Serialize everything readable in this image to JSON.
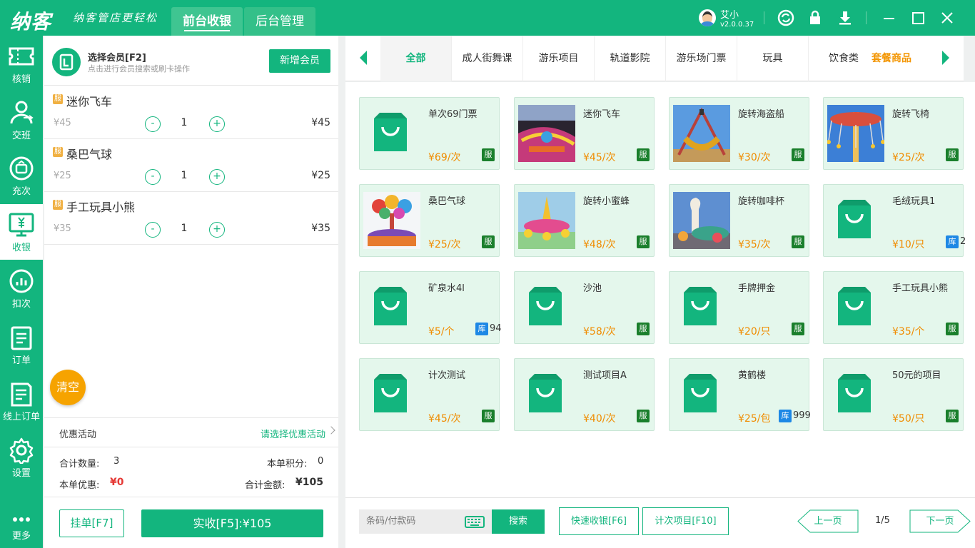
{
  "app": {
    "logo": "纳客",
    "slogan": "纳客管店更轻松",
    "tabs": [
      {
        "label": "前台收银",
        "active": true
      },
      {
        "label": "后台管理",
        "active": false
      }
    ],
    "user": {
      "name": "艾小",
      "version": "v2.0.0.37"
    },
    "header_icons": [
      "refresh-icon",
      "lock-icon",
      "download-icon",
      "minimize-icon",
      "maximize-icon",
      "close-icon"
    ]
  },
  "sidebar": {
    "items": [
      {
        "label": "核销",
        "icon": "ticket-icon"
      },
      {
        "label": "交班",
        "icon": "handover-icon"
      },
      {
        "label": "充次",
        "icon": "recharge-icon"
      },
      {
        "label": "收银",
        "icon": "cashier-icon",
        "active": true
      },
      {
        "label": "扣次",
        "icon": "deduct-icon"
      },
      {
        "label": "订单",
        "icon": "order-icon"
      },
      {
        "label": "线上订单",
        "icon": "online-order-icon"
      },
      {
        "label": "设置",
        "icon": "gear-icon"
      },
      {
        "label": "更多",
        "icon": "more-icon"
      }
    ]
  },
  "cart": {
    "member_title": "选择会员[F2]",
    "member_hint": "点击进行会员搜索或刷卡操作",
    "add_member": "新增会员",
    "items": [
      {
        "badge": "服",
        "name": "迷你飞车",
        "price": "¥45",
        "qty": "1",
        "subtotal": "¥45"
      },
      {
        "badge": "服",
        "name": "桑巴气球",
        "price": "¥25",
        "qty": "1",
        "subtotal": "¥25"
      },
      {
        "badge": "服",
        "name": "手工玩具小熊",
        "price": "¥35",
        "qty": "1",
        "subtotal": "¥35"
      }
    ],
    "minus": "-",
    "plus": "+",
    "clear": "清空",
    "promo_label": "优惠活动",
    "promo_select": "请选择优惠活动",
    "total_qty_label": "合计数量:",
    "total_qty": "3",
    "points_label": "本单积分:",
    "points": "0",
    "discount_label": "本单优惠:",
    "discount": "¥0",
    "total_label": "合计金额:",
    "total": "¥105",
    "hang_btn": "挂单[F7]",
    "pay_btn": "实收[F5]:¥105"
  },
  "categories": [
    {
      "label": "全部",
      "active": true
    },
    {
      "label": "成人街舞课"
    },
    {
      "label": "游乐项目"
    },
    {
      "label": "轨道影院"
    },
    {
      "label": "游乐场门票"
    },
    {
      "label": "玩具"
    },
    {
      "label": "饮食类"
    },
    {
      "label": "套餐商品",
      "special": true
    }
  ],
  "products": [
    {
      "name": "单次69门票",
      "price": "¥69/次",
      "tag": "服",
      "img": "bag"
    },
    {
      "name": "迷你飞车",
      "price": "¥45/次",
      "tag": "服",
      "img": "minicar"
    },
    {
      "name": "旋转海盗船",
      "price": "¥30/次",
      "tag": "服",
      "img": "pirate"
    },
    {
      "name": "旋转飞椅",
      "price": "¥25/次",
      "tag": "服",
      "img": "chair"
    },
    {
      "name": "桑巴气球",
      "price": "¥25/次",
      "tag": "服",
      "img": "balloon"
    },
    {
      "name": "旋转小蜜蜂",
      "price": "¥48/次",
      "tag": "服",
      "img": "bee"
    },
    {
      "name": "旋转咖啡杯",
      "price": "¥35/次",
      "tag": "服",
      "img": "cup"
    },
    {
      "name": "毛绒玩具1",
      "price": "¥10/只",
      "tag": "库",
      "stock": "2",
      "img": "bag"
    },
    {
      "name": "矿泉水4l",
      "price": "¥5/个",
      "tag": "库",
      "stock": "94",
      "img": "bag"
    },
    {
      "name": "沙池",
      "price": "¥58/次",
      "tag": "服",
      "img": "bag"
    },
    {
      "name": "手牌押金",
      "price": "¥20/只",
      "tag": "服",
      "img": "bag"
    },
    {
      "name": "手工玩具小熊",
      "price": "¥35/个",
      "tag": "服",
      "img": "bag"
    },
    {
      "name": "计次测试",
      "price": "¥45/次",
      "tag": "服",
      "img": "bag"
    },
    {
      "name": "测试项目A",
      "price": "¥40/次",
      "tag": "服",
      "img": "bag"
    },
    {
      "name": "黄鹤楼",
      "price": "¥25/包",
      "tag": "库",
      "stock": "999",
      "img": "bag"
    },
    {
      "name": "50元的项目",
      "price": "¥50/只",
      "tag": "服",
      "img": "bag"
    }
  ],
  "bottom": {
    "scan_placeholder": "条码/付款码",
    "search": "搜索",
    "quick_cash": "快速收银[F6]",
    "count_item": "计次项目[F10]",
    "prev": "上一页",
    "next": "下一页",
    "page": "1/5"
  },
  "colors": {
    "primary": "#13b57e",
    "price": "#f08c00",
    "service_tag": "#1a7f2c",
    "stock_tag": "#1e88e5",
    "clear": "#f6a300"
  }
}
